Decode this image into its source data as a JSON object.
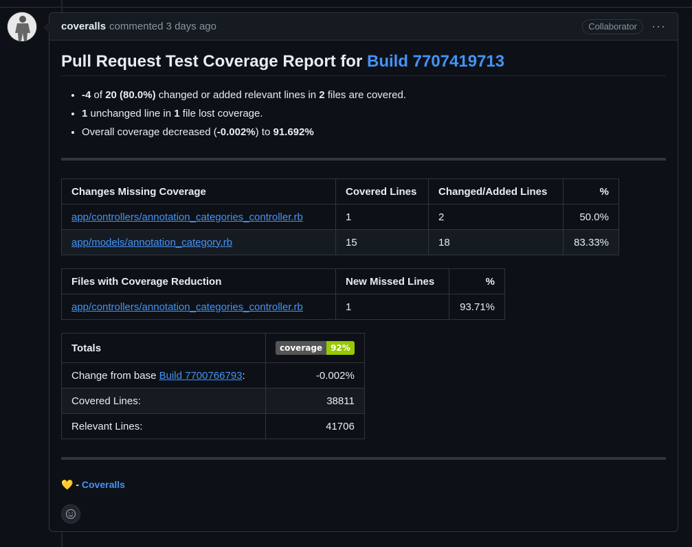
{
  "comment": {
    "author": "coveralls",
    "meta": "commented 3 days ago",
    "role_badge": "Collaborator",
    "menu_icon": "kebab-horizontal-icon"
  },
  "report": {
    "title_prefix": "Pull Request Test Coverage Report for ",
    "title_link": "Build 7707419713",
    "summary": {
      "line1": {
        "a": "-4",
        "b": " of ",
        "c": "20 (80.0%)",
        "d": " changed or added relevant lines in ",
        "e": "2",
        "f": " files are covered."
      },
      "line2": {
        "a": "1",
        "b": " unchanged line in ",
        "c": "1",
        "d": " file lost coverage."
      },
      "line3": {
        "a": "Overall coverage decreased (",
        "b": "-0.002%",
        "c": ") to ",
        "d": "91.692%"
      }
    }
  },
  "changes_table": {
    "headers": [
      "Changes Missing Coverage",
      "Covered Lines",
      "Changed/Added Lines",
      "%"
    ],
    "rows": [
      {
        "file": "app/controllers/annotation_categories_controller.rb",
        "covered": "1",
        "changed": "2",
        "pct": "50.0%"
      },
      {
        "file": "app/models/annotation_category.rb",
        "covered": "15",
        "changed": "18",
        "pct": "83.33%"
      }
    ]
  },
  "reduction_table": {
    "headers": [
      "Files with Coverage Reduction",
      "New Missed Lines",
      "%"
    ],
    "rows": [
      {
        "file": "app/controllers/annotation_categories_controller.rb",
        "missed": "1",
        "pct": "93.71%"
      }
    ]
  },
  "totals_table": {
    "header": "Totals",
    "badge_label": "coverage",
    "badge_value": "92%",
    "change_label_prefix": "Change from base ",
    "change_link": "Build 7700766793",
    "change_suffix": ":",
    "change_value": "-0.002%",
    "covered_label": "Covered Lines:",
    "covered_value": "38811",
    "relevant_label": "Relevant Lines:",
    "relevant_value": "41706"
  },
  "footer": {
    "heart": "💛",
    "dash": " - ",
    "link": "Coveralls"
  },
  "colors": {
    "background": "#0d1117",
    "link": "#4493f8",
    "badge_green": "#97ca00"
  }
}
